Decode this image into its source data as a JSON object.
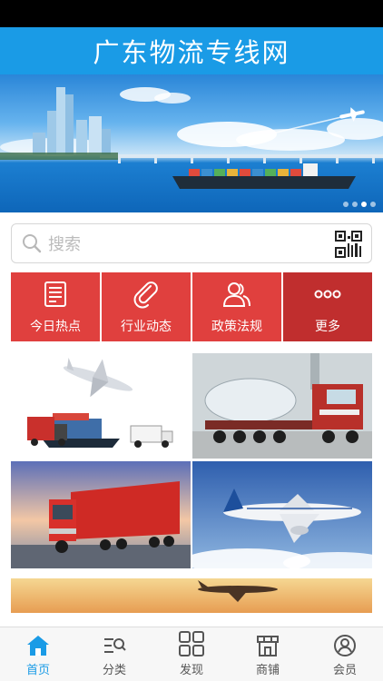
{
  "header": {
    "title": "广东物流专线网"
  },
  "banner": {
    "slide_count": 4,
    "active_index": 2
  },
  "search": {
    "placeholder": "搜索"
  },
  "quick_nav": [
    {
      "label": "今日热点",
      "icon": "newspaper-icon"
    },
    {
      "label": "行业动态",
      "icon": "paperclip-icon"
    },
    {
      "label": "政策法规",
      "icon": "people-icon"
    },
    {
      "label": "更多",
      "icon": "more-dots-icon"
    }
  ],
  "tiles": [
    {
      "name": "plane-ship-truck-image"
    },
    {
      "name": "heavy-cargo-truck-image"
    },
    {
      "name": "red-truck-sunset-image"
    },
    {
      "name": "passenger-plane-image"
    },
    {
      "name": "cargo-plane-sunset-image"
    }
  ],
  "bottom_nav": [
    {
      "label": "首页",
      "icon": "home-icon",
      "active": true
    },
    {
      "label": "分类",
      "icon": "category-search-icon",
      "active": false
    },
    {
      "label": "发现",
      "icon": "grid-icon",
      "active": false
    },
    {
      "label": "商铺",
      "icon": "shop-icon",
      "active": false
    },
    {
      "label": "会员",
      "icon": "user-icon",
      "active": false
    }
  ],
  "colors": {
    "primary": "#1a9be6",
    "quick_nav_red": "#e0403e",
    "quick_nav_dark_red": "#c02e2e"
  }
}
